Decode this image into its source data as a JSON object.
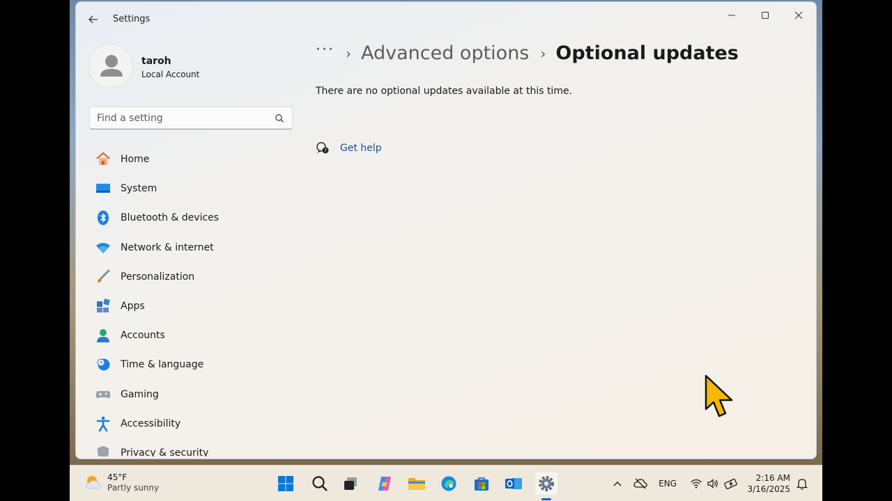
{
  "window": {
    "title": "Settings",
    "controls": {
      "minimize": "minimize-icon",
      "maximize": "maximize-icon",
      "close": "close-icon"
    }
  },
  "profile": {
    "name": "taroh",
    "account_type": "Local Account"
  },
  "search": {
    "placeholder": "Find a setting",
    "value": ""
  },
  "sidebar": {
    "items": [
      {
        "label": "Home",
        "icon": "home-icon"
      },
      {
        "label": "System",
        "icon": "system-icon"
      },
      {
        "label": "Bluetooth & devices",
        "icon": "bluetooth-icon"
      },
      {
        "label": "Network & internet",
        "icon": "wifi-icon"
      },
      {
        "label": "Personalization",
        "icon": "brush-icon"
      },
      {
        "label": "Apps",
        "icon": "apps-icon"
      },
      {
        "label": "Accounts",
        "icon": "accounts-icon"
      },
      {
        "label": "Time & language",
        "icon": "clock-globe-icon"
      },
      {
        "label": "Gaming",
        "icon": "gamepad-icon"
      },
      {
        "label": "Accessibility",
        "icon": "accessibility-icon"
      },
      {
        "label": "Privacy & security",
        "icon": "shield-icon"
      }
    ]
  },
  "breadcrumb": {
    "more": "···",
    "parent": "Advanced options",
    "current": "Optional updates"
  },
  "main": {
    "info": "There are no optional updates available at this time.",
    "help_label": "Get help"
  },
  "taskbar": {
    "weather": {
      "temperature": "45°F",
      "condition": "Partly sunny"
    },
    "pinned": [
      "start-icon",
      "search-icon",
      "task-view-icon",
      "copilot-icon",
      "file-explorer-icon",
      "edge-icon",
      "store-icon",
      "outlook-icon",
      "settings-icon"
    ],
    "tray": {
      "language": "ENG"
    },
    "clock": {
      "time": "2:16 AM",
      "date": "3/16/2025"
    }
  },
  "colors": {
    "accent": "#0067c0",
    "link": "#1b4f8a",
    "window_bg": "#f3f1ee"
  }
}
